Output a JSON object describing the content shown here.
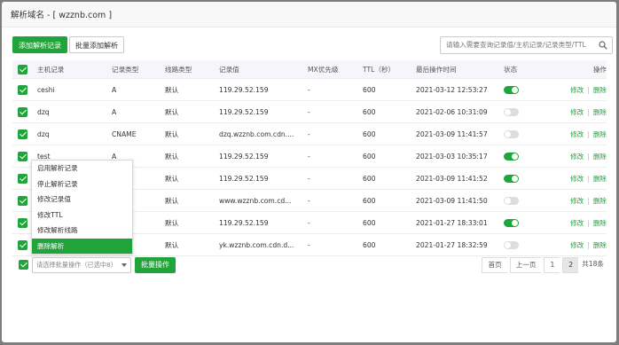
{
  "dialog": {
    "title": "解析域名 - [ wzznb.com ]"
  },
  "toolbar": {
    "add_label": "添加解析记录",
    "batch_add_label": "批量添加解析",
    "search_placeholder": "请输入需要查询记录值/主机记录/记录类型/TTL"
  },
  "table": {
    "headers": [
      "主机记录",
      "记录类型",
      "线路类型",
      "记录值",
      "MX优先级",
      "TTL（秒）",
      "最后操作时间",
      "状态",
      "操作"
    ],
    "rows": [
      {
        "host": "ceshi",
        "type": "A",
        "line": "默认",
        "value": "119.29.52.159",
        "mx": "-",
        "ttl": "600",
        "time": "2021-03-12 12:53:27",
        "enabled": true
      },
      {
        "host": "dzq",
        "type": "A",
        "line": "默认",
        "value": "119.29.52.159",
        "mx": "-",
        "ttl": "600",
        "time": "2021-02-06 10:31:09",
        "enabled": false
      },
      {
        "host": "dzq",
        "type": "CNAME",
        "line": "默认",
        "value": "dzq.wzznb.com.cdn....",
        "mx": "-",
        "ttl": "600",
        "time": "2021-03-09 11:41:57",
        "enabled": false
      },
      {
        "host": "test",
        "type": "A",
        "line": "默认",
        "value": "119.29.52.159",
        "mx": "-",
        "ttl": "600",
        "time": "2021-03-03 10:35:17",
        "enabled": true
      },
      {
        "host": "",
        "type": "",
        "line": "默认",
        "value": "119.29.52.159",
        "mx": "-",
        "ttl": "600",
        "time": "2021-03-09 11:41:52",
        "enabled": true
      },
      {
        "host": "",
        "type": "AME",
        "line": "默认",
        "value": "www.wzznb.com.cd...",
        "mx": "-",
        "ttl": "600",
        "time": "2021-03-09 11:41:50",
        "enabled": false
      },
      {
        "host": "",
        "type": "",
        "line": "默认",
        "value": "119.29.52.159",
        "mx": "-",
        "ttl": "600",
        "time": "2021-01-27 18:33:01",
        "enabled": true
      },
      {
        "host": "",
        "type": "AME",
        "line": "默认",
        "value": "yk.wzznb.com.cdn.d...",
        "mx": "-",
        "ttl": "600",
        "time": "2021-01-27 18:32:59",
        "enabled": false
      }
    ],
    "edit_label": "修改",
    "delete_label": "删除",
    "separator": "|"
  },
  "batch_menu": {
    "items": [
      "启用解析记录",
      "停止解析记录",
      "修改记录值",
      "修改TTL",
      "修改解析线路",
      "删除解析"
    ],
    "active_index": 5
  },
  "footer": {
    "select_placeholder": "请选择批量操作（已选中8）",
    "batch_button": "批量操作",
    "pager": {
      "first": "首页",
      "prev": "上一页",
      "page1": "1",
      "page2": "2",
      "total": "共18条"
    }
  },
  "colors": {
    "accent": "#20a53a",
    "overlay": "#7d7d7d"
  }
}
